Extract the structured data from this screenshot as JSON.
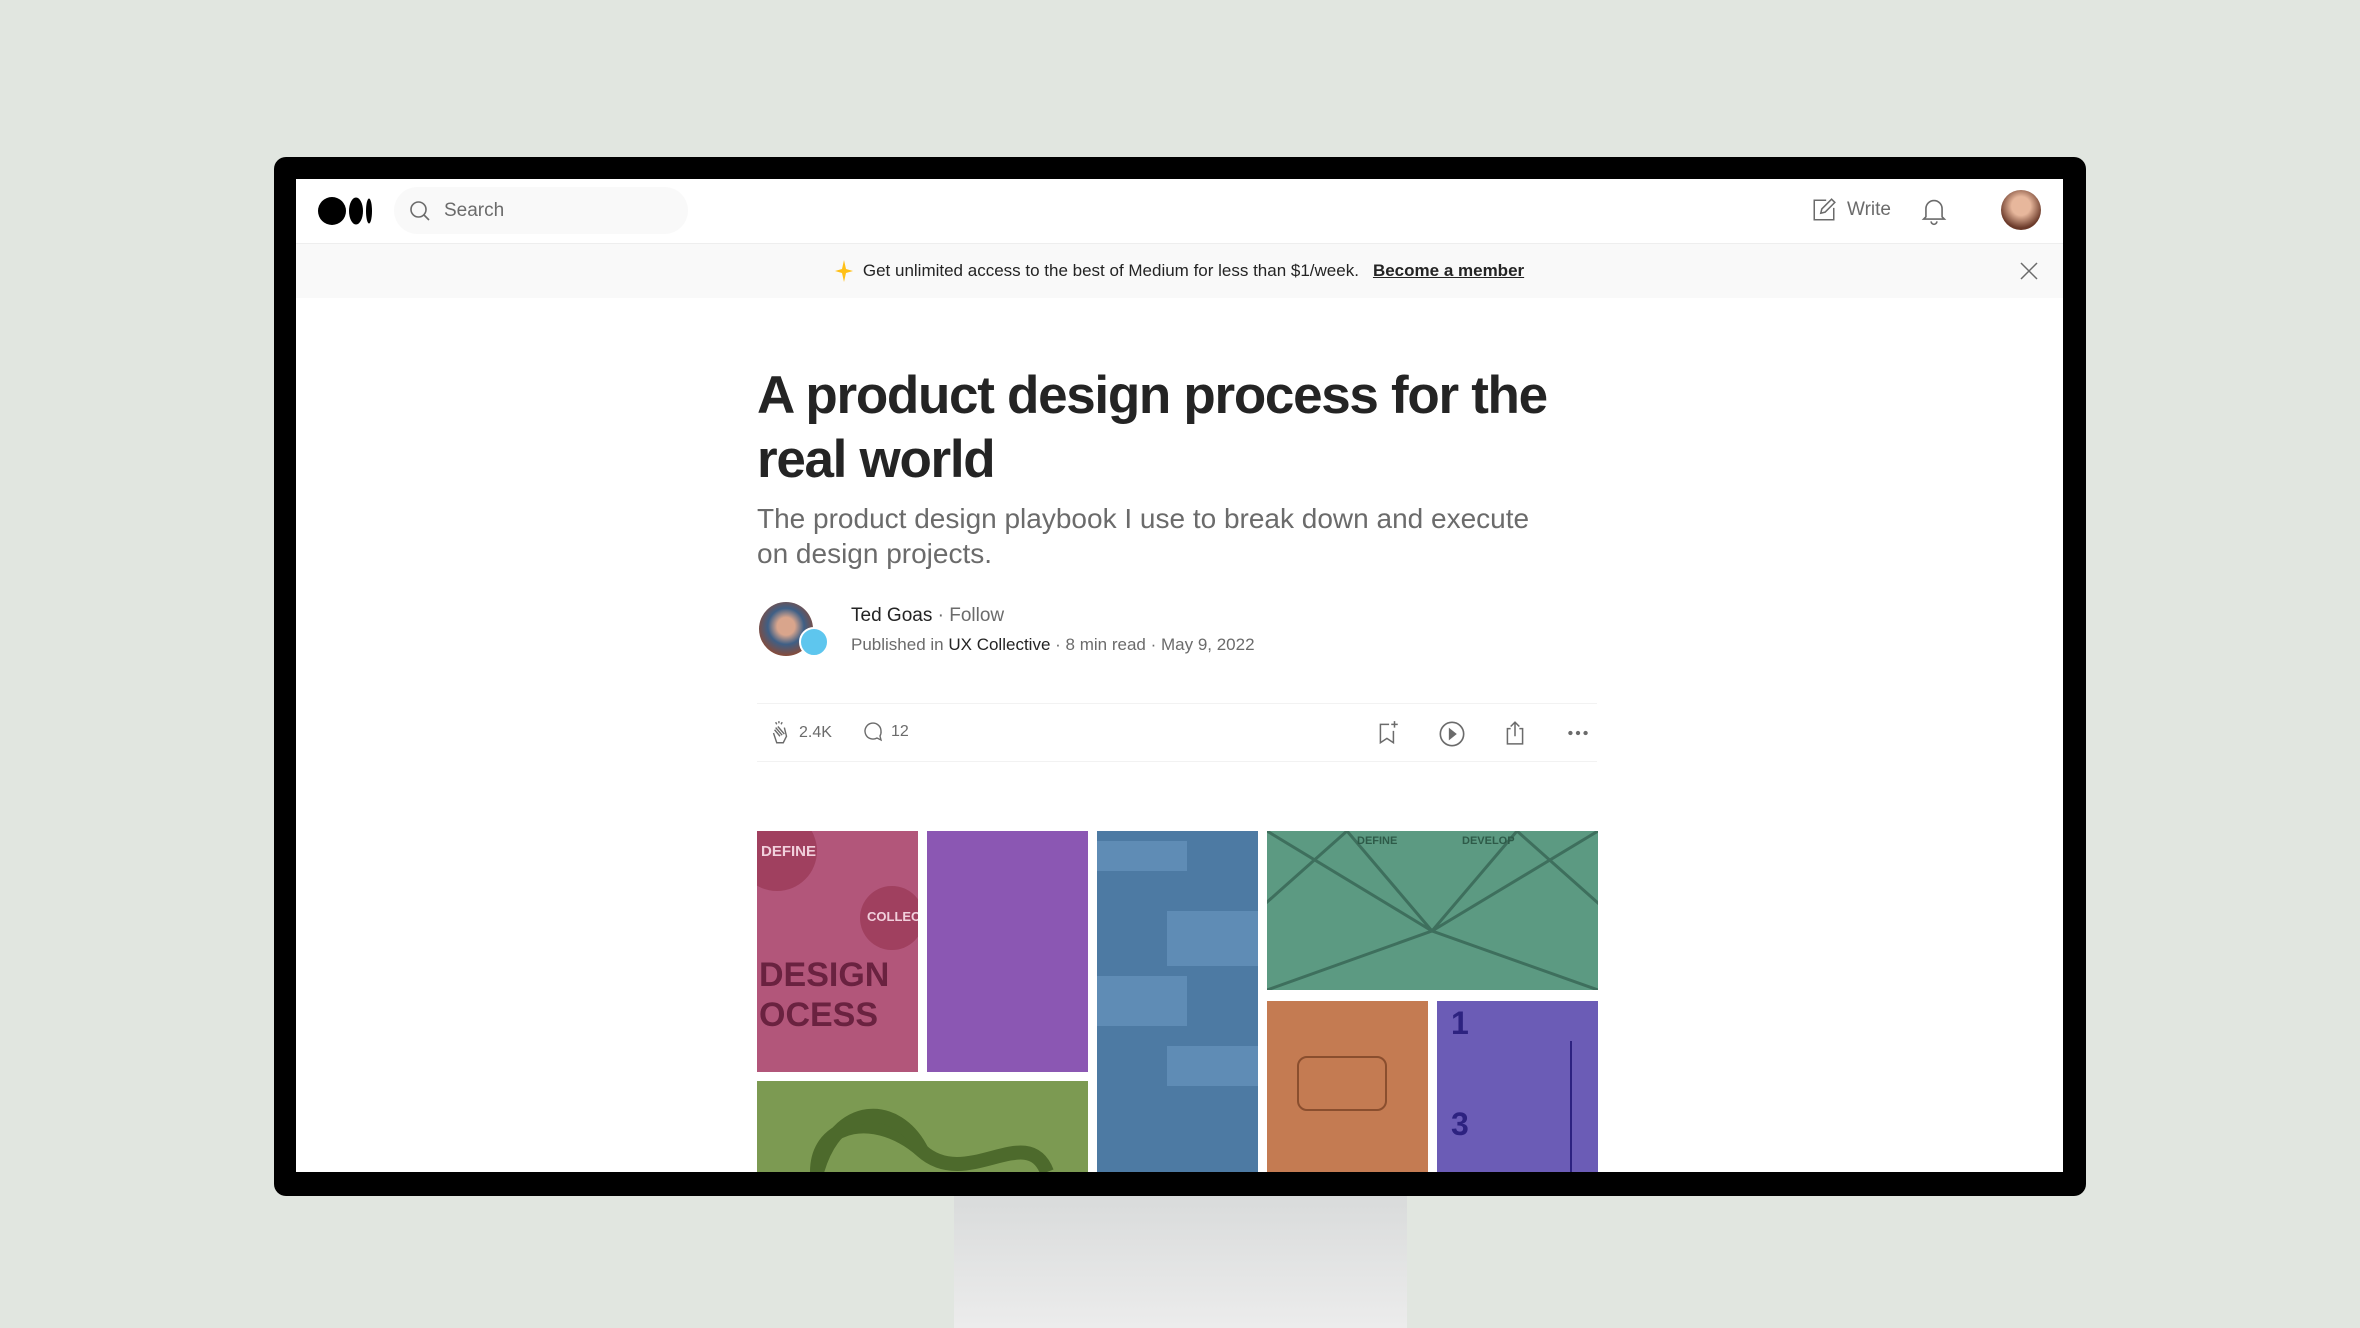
{
  "nav": {
    "search_placeholder": "Search",
    "write_label": "Write"
  },
  "banner": {
    "text": "Get unlimited access to the best of Medium for less than $1/week.",
    "link": "Become a member"
  },
  "article": {
    "title": "A product design process for the real world",
    "subtitle": "The product design playbook I use to break down and execute on design projects.",
    "author": "Ted Goas",
    "follow": "Follow",
    "published_in_prefix": "Published in",
    "publication": "UX Collective",
    "read_time": "8 min read",
    "date": "May 9, 2022",
    "claps": "2.4K",
    "responses": "12"
  },
  "hero_image": {
    "labels": {
      "define": "DEFINE",
      "collect": "COLLECT",
      "design": "DESIGN",
      "ocess": "OCESS",
      "define2": "DEFINE",
      "develop": "DEVELOP",
      "one": "1",
      "three": "3"
    }
  },
  "colors": {
    "pink": "#b2567a",
    "purple": "#8b57b3",
    "blue": "#4d7aa3",
    "green": "#5c9a82",
    "orange": "#c47b52",
    "indigo": "#6b5cb6",
    "olive": "#7c9a52",
    "accent_star": "#ffc017"
  }
}
